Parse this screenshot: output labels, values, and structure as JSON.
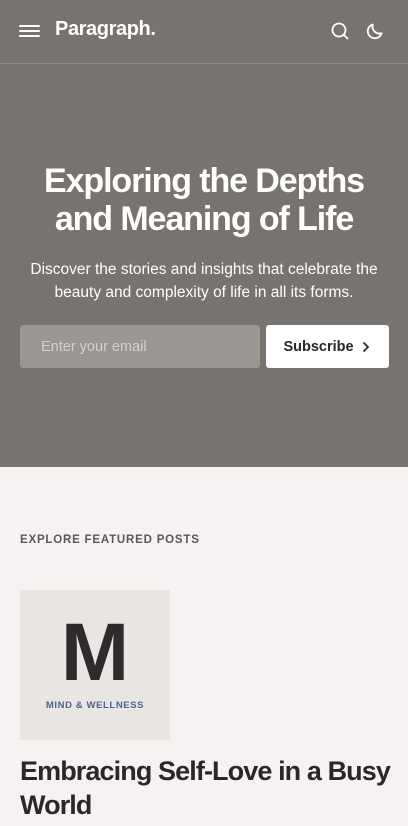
{
  "header": {
    "logo": "Paragraph.",
    "icons": {
      "menu": "hamburger-menu-icon",
      "search": "search-icon",
      "theme": "moon-icon"
    }
  },
  "hero": {
    "title": "Exploring the Depths and Meaning of Life",
    "subtitle": "Discover the stories and insights that celebrate the beauty and complexity of life in all its forms.",
    "email_placeholder": "Enter your email",
    "email_value": "",
    "subscribe_label": "Subscribe",
    "subscribe_icon": "chevron-right-icon"
  },
  "featured": {
    "section_label": "EXPLORE FEATURED POSTS",
    "posts": [
      {
        "thumb_letter": "M",
        "category": "MIND & WELLNESS",
        "title": "Embracing Self-Love in a Busy World"
      }
    ]
  },
  "colors": {
    "hero_bg": "#78736e",
    "page_bg": "#f6f2f2",
    "input_bg": "#9a9692",
    "thumb_bg": "#e9e5e3",
    "category_color": "#4d6291",
    "text_dark": "#2a2727"
  }
}
